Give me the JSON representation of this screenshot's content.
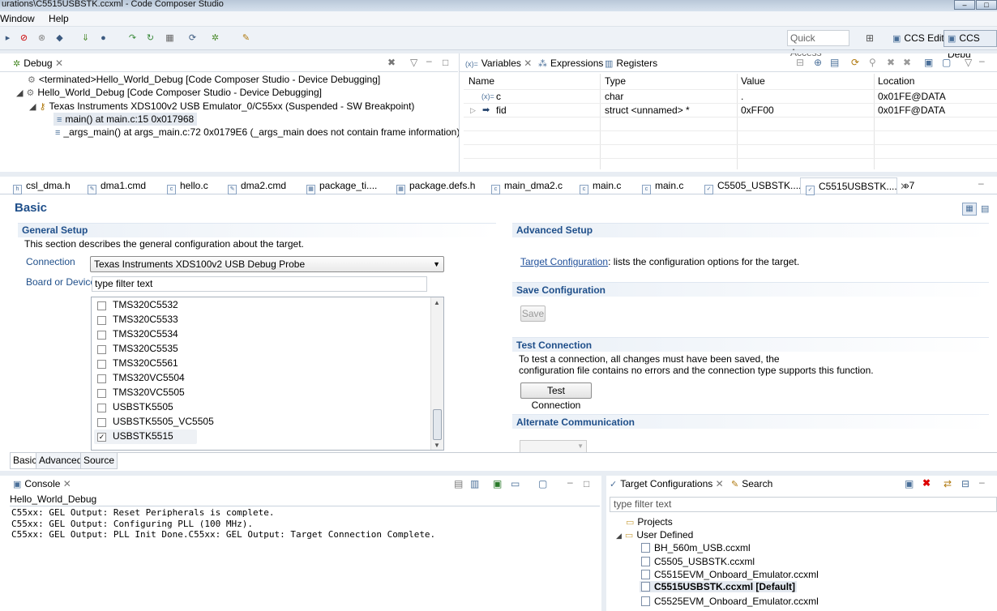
{
  "window": {
    "title": "urations\\C5515USBSTK.ccxml - Code Composer Studio"
  },
  "menu": [
    "Window",
    "Help"
  ],
  "toolbar": {
    "quick_access": "Quick Access",
    "ccs_edit": "CCS Edit",
    "ccs_debug": "CCS Debu"
  },
  "debug": {
    "tab": "Debug",
    "items": [
      "<terminated>Hello_World_Debug [Code Composer Studio - Device Debugging]",
      "Hello_World_Debug [Code Composer Studio - Device Debugging]",
      "Texas Instruments XDS100v2 USB Emulator_0/C55xx (Suspended - SW Breakpoint)",
      "main() at main.c:15 0x017968",
      "_args_main() at args_main.c:72 0x0179E6  (_args_main does not contain frame information)"
    ]
  },
  "vars": {
    "tabs": [
      "Variables",
      "Expressions",
      "Registers"
    ],
    "columns": [
      "Name",
      "Type",
      "Value",
      "Location"
    ],
    "rows": [
      {
        "name": "c",
        "type": "char",
        "value": ".",
        "location": "0x01FE@DATA"
      },
      {
        "name": "fid",
        "type": "struct <unnamed> *",
        "value": "0xFF00",
        "location": "0x01FF@DATA"
      }
    ]
  },
  "editor_tabs": [
    "csl_dma.h",
    "dma1.cmd",
    "hello.c",
    "dma2.cmd",
    "package_ti....",
    "package.defs.h",
    "main_dma2.c",
    "main.c",
    "main.c",
    "C5505_USBSTK....",
    "C5515USBSTK...."
  ],
  "editor_tab_overflow": "»7",
  "basic": {
    "title": "Basic",
    "general": {
      "heading": "General Setup",
      "desc": "This section describes the general configuration about the target.",
      "connection_label": "Connection",
      "connection_value": "Texas Instruments XDS100v2 USB Debug Probe",
      "board_label": "Board or Device",
      "filter_value": "type filter text",
      "devices": [
        {
          "name": "TMS320C5532",
          "checked": false
        },
        {
          "name": "TMS320C5533",
          "checked": false
        },
        {
          "name": "TMS320C5534",
          "checked": false
        },
        {
          "name": "TMS320C5535",
          "checked": false
        },
        {
          "name": "TMS320C5561",
          "checked": false
        },
        {
          "name": "TMS320VC5504",
          "checked": false
        },
        {
          "name": "TMS320VC5505",
          "checked": false
        },
        {
          "name": "USBSTK5505",
          "checked": false
        },
        {
          "name": "USBSTK5505_VC5505",
          "checked": false
        },
        {
          "name": "USBSTK5515",
          "checked": true
        }
      ]
    },
    "advanced": {
      "heading": "Advanced Setup",
      "link": "Target Configuration",
      "link_rest": ": lists the configuration options for the target.",
      "save_heading": "Save Configuration",
      "save_button": "Save",
      "test_heading": "Test Connection",
      "test_desc1": "To test a connection, all changes must have been saved, the",
      "test_desc2": "configuration file contains no errors and the connection type supports this function.",
      "test_button": "Test Connection",
      "alt_heading": "Alternate Communication"
    },
    "bottom_tabs": [
      "Basic",
      "Advanced",
      "Source"
    ]
  },
  "console": {
    "tab": "Console",
    "name": "Hello_World_Debug",
    "lines": [
      "C55xx: GEL Output: Reset Peripherals is complete.",
      "C55xx: GEL Output: Configuring PLL (100 MHz).",
      "C55xx: GEL Output: PLL Init Done.C55xx: GEL Output: Target Connection Complete."
    ]
  },
  "targets": {
    "tabs": [
      "Target Configurations",
      "Search"
    ],
    "filter": "type filter text",
    "projects": "Projects",
    "user_defined": "User Defined",
    "files": [
      "BH_560m_USB.ccxml",
      "C5505_USBSTK.ccxml",
      "C5515EVM_Onboard_Emulator.ccxml",
      "C5515USBSTK.ccxml [Default]",
      "C5525EVM_Onboard_Emulator.ccxml"
    ]
  }
}
